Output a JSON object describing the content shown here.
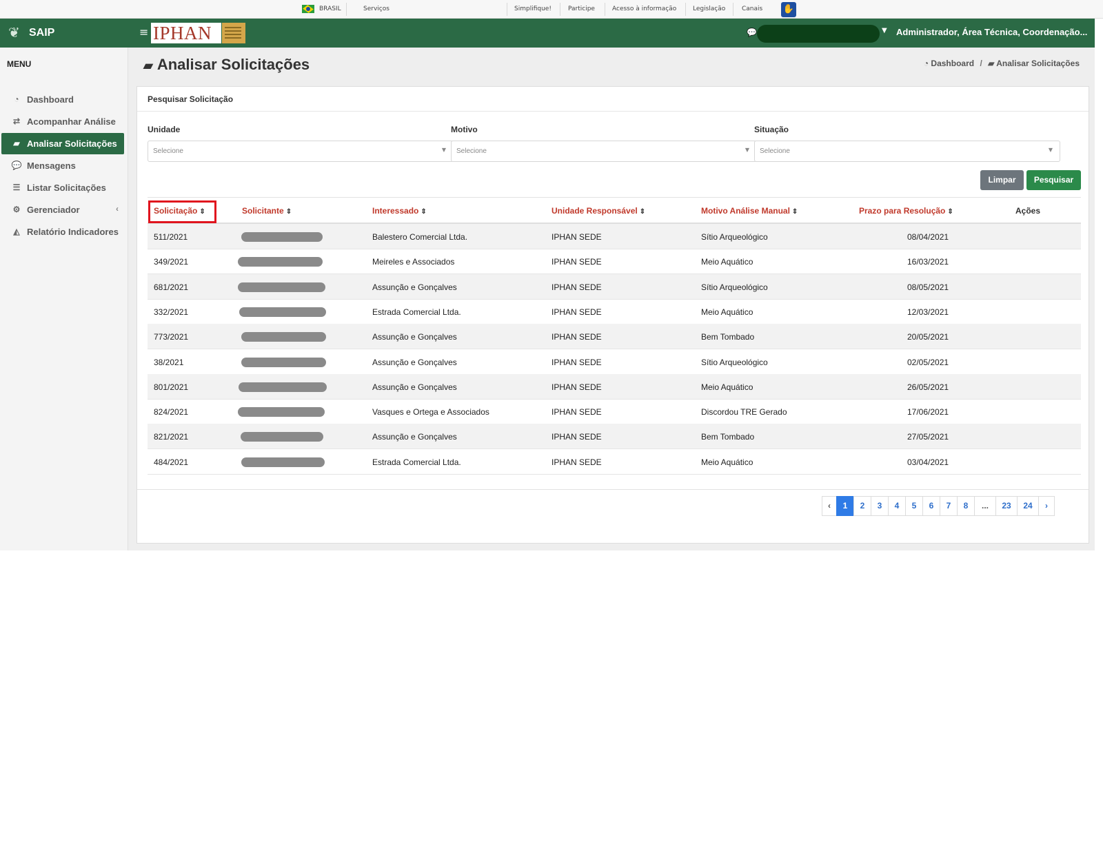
{
  "govbar": {
    "country": "BRASIL",
    "links": [
      "Serviços",
      "Simplifique!",
      "Participe",
      "Acesso à informação",
      "Legislação",
      "Canais"
    ]
  },
  "brand": {
    "name": "SAIP"
  },
  "header": {
    "logo_text": "IPHAN",
    "user_info": "Administrador, Área Técnica, Coordenação..."
  },
  "sidebar": {
    "menu_title": "MENU",
    "items": [
      {
        "label": "Dashboard",
        "icon": "dashboard-icon"
      },
      {
        "label": "Acompanhar Análise",
        "icon": "exchange-icon"
      },
      {
        "label": "Analisar Solicitações",
        "icon": "book-icon",
        "active": true
      },
      {
        "label": "Mensagens",
        "icon": "comments-icon"
      },
      {
        "label": "Listar Solicitações",
        "icon": "list-icon"
      },
      {
        "label": "Gerenciador",
        "icon": "gears-icon",
        "has_submenu": true
      },
      {
        "label": "Relatório Indicadores",
        "icon": "area-chart-icon"
      }
    ]
  },
  "page": {
    "title": "Analisar Solicitações",
    "breadcrumb": [
      "Dashboard",
      "Analisar Solicitações"
    ]
  },
  "search_panel": {
    "title": "Pesquisar Solicitação",
    "filters": [
      {
        "label": "Unidade",
        "placeholder": "Selecione"
      },
      {
        "label": "Motivo",
        "placeholder": "Selecione"
      },
      {
        "label": "Situação",
        "placeholder": "Selecione"
      }
    ],
    "clear_label": "Limpar",
    "search_label": "Pesquisar"
  },
  "table": {
    "columns": [
      "Solicitação",
      "Solicitante",
      "Interessado",
      "Unidade Responsável",
      "Motivo Análise Manual",
      "Prazo para Resolução",
      "Ações"
    ],
    "rows": [
      {
        "solicitacao": "511/2021",
        "interessado": "Balestero Comercial Ltda.",
        "unidade": "IPHAN SEDE",
        "motivo": "Sítio Arqueológico",
        "prazo": "08/04/2021"
      },
      {
        "solicitacao": "349/2021",
        "interessado": "Meireles e Associados",
        "unidade": "IPHAN SEDE",
        "motivo": "Meio Aquático",
        "prazo": "16/03/2021"
      },
      {
        "solicitacao": "681/2021",
        "interessado": "Assunção e Gonçalves",
        "unidade": "IPHAN SEDE",
        "motivo": "Sítio Arqueológico",
        "prazo": "08/05/2021"
      },
      {
        "solicitacao": "332/2021",
        "interessado": "Estrada Comercial Ltda.",
        "unidade": "IPHAN SEDE",
        "motivo": "Meio Aquático",
        "prazo": "12/03/2021"
      },
      {
        "solicitacao": "773/2021",
        "interessado": "Assunção e Gonçalves",
        "unidade": "IPHAN SEDE",
        "motivo": "Bem Tombado",
        "prazo": "20/05/2021"
      },
      {
        "solicitacao": "38/2021",
        "interessado": "Assunção e Gonçalves",
        "unidade": "IPHAN SEDE",
        "motivo": "Sítio Arqueológico",
        "prazo": "02/05/2021"
      },
      {
        "solicitacao": "801/2021",
        "interessado": "Assunção e Gonçalves",
        "unidade": "IPHAN SEDE",
        "motivo": "Meio Aquático",
        "prazo": "26/05/2021"
      },
      {
        "solicitacao": "824/2021",
        "interessado": "Vasques e Ortega e Associados",
        "unidade": "IPHAN SEDE",
        "motivo": "Discordou TRE Gerado",
        "prazo": "17/06/2021"
      },
      {
        "solicitacao": "821/2021",
        "interessado": "Assunção e Gonçalves",
        "unidade": "IPHAN SEDE",
        "motivo": "Bem Tombado",
        "prazo": "27/05/2021"
      },
      {
        "solicitacao": "484/2021",
        "interessado": "Estrada Comercial Ltda.",
        "unidade": "IPHAN SEDE",
        "motivo": "Meio Aquático",
        "prazo": "03/04/2021"
      }
    ]
  },
  "pagination": {
    "prev": "‹",
    "pages": [
      "1",
      "2",
      "3",
      "4",
      "5",
      "6",
      "7",
      "8",
      "...",
      "23",
      "24"
    ],
    "next": "›",
    "current": "1"
  },
  "colors": {
    "brand_green": "#2b6a45",
    "header_link_red": "#c0392b",
    "highlight_red": "#e0141e",
    "pagination_blue": "#2f7be6"
  }
}
